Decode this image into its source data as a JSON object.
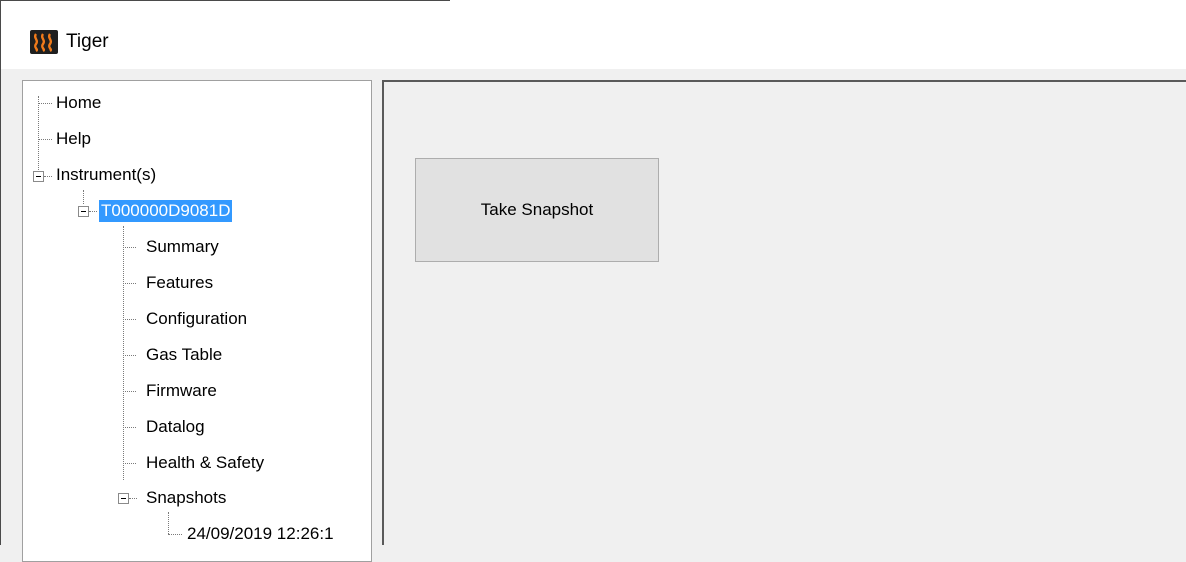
{
  "app": {
    "title": "Tiger",
    "icon": "heat-waves-icon",
    "icon_color": "#f07a1a"
  },
  "tree": {
    "items": [
      {
        "label": "Home"
      },
      {
        "label": "Help"
      },
      {
        "label": "Instrument(s)"
      },
      {
        "label": "T000000D9081D",
        "selected": true
      },
      {
        "label": "Summary"
      },
      {
        "label": "Features"
      },
      {
        "label": "Configuration"
      },
      {
        "label": "Gas Table"
      },
      {
        "label": "Firmware"
      },
      {
        "label": "Datalog"
      },
      {
        "label": "Health & Safety"
      },
      {
        "label": "Snapshots"
      },
      {
        "label": "24/09/2019 12:26:1"
      }
    ],
    "selection_color": "#3399ff"
  },
  "content": {
    "take_snapshot_label": "Take Snapshot"
  }
}
